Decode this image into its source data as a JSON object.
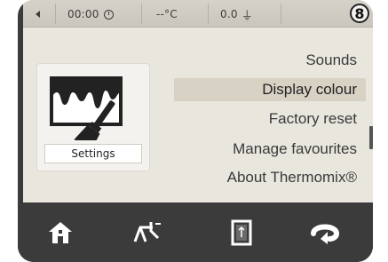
{
  "status_bar": {
    "back_icon": "left-arrow-icon",
    "timer": "00:00",
    "timer_icon": "clock-icon",
    "temperature": "--°C",
    "weight": "0.0",
    "weight_icon": "scale-weight-icon"
  },
  "step_badge": "8",
  "settings_tile": {
    "label": "Settings",
    "icon": "paint-brush-display-icon"
  },
  "menu": {
    "items": [
      {
        "label": "Sounds"
      },
      {
        "label": "Display colour",
        "selected": true
      },
      {
        "label": "Factory reset"
      },
      {
        "label": "Manage favourites"
      },
      {
        "label": "About Thermomix®"
      }
    ]
  },
  "bottom_nav": {
    "items": [
      {
        "icon": "home-icon"
      },
      {
        "icon": "scale-icon"
      },
      {
        "icon": "recipe-book-icon"
      },
      {
        "icon": "cycle-icon"
      }
    ]
  },
  "colors": {
    "screen_bg": "#e9e6de",
    "selected_bg": "#d8d2c5",
    "frame": "#3b3b3b",
    "icon_white": "#ffffff"
  }
}
